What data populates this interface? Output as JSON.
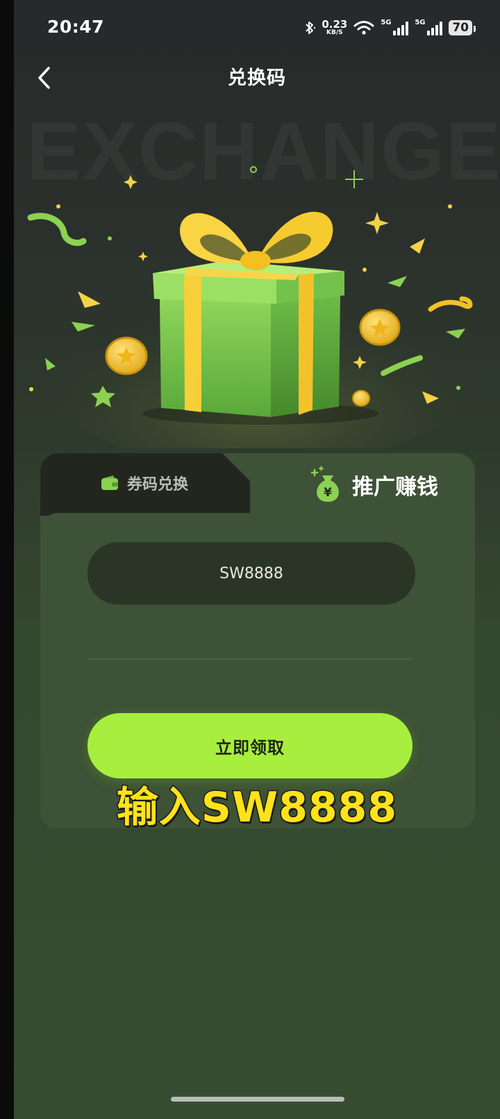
{
  "status_bar": {
    "time": "20:47",
    "net_speed_value": "0.23",
    "net_speed_unit": "KB/S",
    "sim1_label": "5G",
    "sim2_label": "5G",
    "battery": "70"
  },
  "header": {
    "title": "兑换码",
    "back_icon": "chevron-left-icon"
  },
  "hero": {
    "watermark": "EXCHANGE",
    "image": "gift-box-with-coins-illustration"
  },
  "tabs": [
    {
      "label": "券码兑换",
      "icon": "wallet-icon",
      "active": false
    },
    {
      "label": "推广赚钱",
      "icon": "money-bag-icon",
      "active": true
    }
  ],
  "form": {
    "code_value": "SW8888",
    "claim_label": "立即领取"
  },
  "caption": "输入SW8888",
  "colors": {
    "accent": "#a8ee3e",
    "panel": "#3d5236",
    "caption": "#ffe21a"
  }
}
